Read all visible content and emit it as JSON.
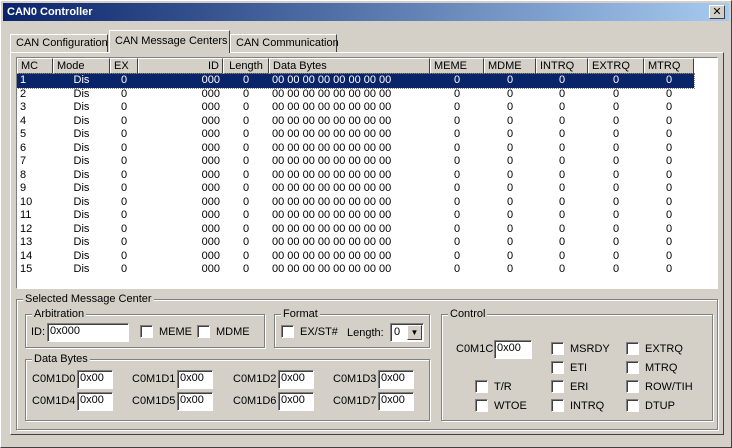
{
  "window": {
    "title": "CAN0 Controller",
    "close": "✕"
  },
  "tabs": [
    "CAN Configuration",
    "CAN Message Centers",
    "CAN Communication"
  ],
  "table": {
    "headers": [
      "MC",
      "Mode",
      "EX",
      "ID",
      "Length",
      "Data Bytes",
      "MEME",
      "MDME",
      "INTRQ",
      "EXTRQ",
      "MTRQ"
    ],
    "rows": [
      [
        "1",
        "Dis",
        "0",
        "000",
        "0",
        "00 00 00 00 00 00 00 00",
        "0",
        "0",
        "0",
        "0",
        "0"
      ],
      [
        "2",
        "Dis",
        "0",
        "000",
        "0",
        "00 00 00 00 00 00 00 00",
        "0",
        "0",
        "0",
        "0",
        "0"
      ],
      [
        "3",
        "Dis",
        "0",
        "000",
        "0",
        "00 00 00 00 00 00 00 00",
        "0",
        "0",
        "0",
        "0",
        "0"
      ],
      [
        "4",
        "Dis",
        "0",
        "000",
        "0",
        "00 00 00 00 00 00 00 00",
        "0",
        "0",
        "0",
        "0",
        "0"
      ],
      [
        "5",
        "Dis",
        "0",
        "000",
        "0",
        "00 00 00 00 00 00 00 00",
        "0",
        "0",
        "0",
        "0",
        "0"
      ],
      [
        "6",
        "Dis",
        "0",
        "000",
        "0",
        "00 00 00 00 00 00 00 00",
        "0",
        "0",
        "0",
        "0",
        "0"
      ],
      [
        "7",
        "Dis",
        "0",
        "000",
        "0",
        "00 00 00 00 00 00 00 00",
        "0",
        "0",
        "0",
        "0",
        "0"
      ],
      [
        "8",
        "Dis",
        "0",
        "000",
        "0",
        "00 00 00 00 00 00 00 00",
        "0",
        "0",
        "0",
        "0",
        "0"
      ],
      [
        "9",
        "Dis",
        "0",
        "000",
        "0",
        "00 00 00 00 00 00 00 00",
        "0",
        "0",
        "0",
        "0",
        "0"
      ],
      [
        "10",
        "Dis",
        "0",
        "000",
        "0",
        "00 00 00 00 00 00 00 00",
        "0",
        "0",
        "0",
        "0",
        "0"
      ],
      [
        "11",
        "Dis",
        "0",
        "000",
        "0",
        "00 00 00 00 00 00 00 00",
        "0",
        "0",
        "0",
        "0",
        "0"
      ],
      [
        "12",
        "Dis",
        "0",
        "000",
        "0",
        "00 00 00 00 00 00 00 00",
        "0",
        "0",
        "0",
        "0",
        "0"
      ],
      [
        "13",
        "Dis",
        "0",
        "000",
        "0",
        "00 00 00 00 00 00 00 00",
        "0",
        "0",
        "0",
        "0",
        "0"
      ],
      [
        "14",
        "Dis",
        "0",
        "000",
        "0",
        "00 00 00 00 00 00 00 00",
        "0",
        "0",
        "0",
        "0",
        "0"
      ],
      [
        "15",
        "Dis",
        "0",
        "000",
        "0",
        "00 00 00 00 00 00 00 00",
        "0",
        "0",
        "0",
        "0",
        "0"
      ]
    ]
  },
  "selected": {
    "title": "Selected Message Center",
    "arbitration": {
      "title": "Arbitration",
      "id_label": "ID:",
      "id_value": "0x000",
      "meme": "MEME",
      "mdme": "MDME"
    },
    "format": {
      "title": "Format",
      "exst": "EX/ST#",
      "length_label": "Length:",
      "length_value": "0"
    },
    "databytes": {
      "title": "Data Bytes",
      "items": [
        {
          "label": "C0M1D0",
          "value": "0x00"
        },
        {
          "label": "C0M1D1",
          "value": "0x00"
        },
        {
          "label": "C0M1D2",
          "value": "0x00"
        },
        {
          "label": "C0M1D3",
          "value": "0x00"
        },
        {
          "label": "C0M1D4",
          "value": "0x00"
        },
        {
          "label": "C0M1D5",
          "value": "0x00"
        },
        {
          "label": "C0M1D6",
          "value": "0x00"
        },
        {
          "label": "C0M1D7",
          "value": "0x00"
        }
      ]
    },
    "control": {
      "title": "Control",
      "c0m1c_label": "C0M1C",
      "c0m1c_value": "0x00",
      "tr": "T/R",
      "wtoe": "WTOE",
      "msrdy": "MSRDY",
      "eti": "ETI",
      "eri": "ERI",
      "intrq": "INTRQ",
      "extrq": "EXTRQ",
      "mtrq": "MTRQ",
      "rowtih": "ROW/TIH",
      "dtup": "DTUP"
    }
  },
  "colors": {
    "selection": "#0a246a",
    "face": "#d4d0c8"
  }
}
